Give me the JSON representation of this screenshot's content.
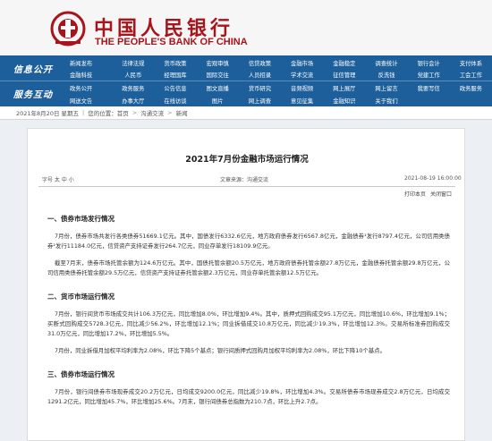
{
  "header": {
    "title_cn": "中国人民银行",
    "title_en": "THE PEOPLE'S BANK OF CHINA"
  },
  "nav": {
    "section1": "信息公开",
    "section2": "服务互动",
    "row1": [
      "新闻发布",
      "法律法规",
      "货币政策",
      "宏观审慎",
      "信贷政策",
      "金融市场",
      "金融稳定",
      "调查统计",
      "银行会计",
      "支付体系"
    ],
    "row2": [
      "金融科技",
      "人民币",
      "经理国库",
      "国际交往",
      "人员招录",
      "学术交流",
      "征信管理",
      "反洗钱",
      "党建工作",
      "工会工作"
    ],
    "row3": [
      "政务公开",
      "政务服务",
      "公告信息",
      "图文直播",
      "货币研究",
      "音频视频",
      "网上展厅",
      "网上留言",
      "我要写信",
      "政务服务"
    ],
    "row4": [
      "网送文告",
      "办事大厅",
      "在线访谈",
      "图片",
      "网上调查",
      "意见征集",
      "金融知识",
      "关于我们"
    ]
  },
  "breadcrumb": {
    "date": "2021年8月20日 星期五",
    "current_label": "您的位置：",
    "home": "首页",
    "section": "沟通交流",
    "page": "新闻"
  },
  "article": {
    "title": "2021年7月份金融市场运行情况",
    "font_label": "字号 太 中 小",
    "source": "文章来源：沟通交流",
    "date": "2021-08-19 16:00:00",
    "tools": [
      "打印本页",
      "关闭窗口"
    ],
    "h1": "一、债券市场发行情况",
    "p1": "7月份，债券市场共发行各类债券51669.1亿元。其中，国债发行6332.6亿元，地方政府债券发行6567.8亿元，金融债券¹发行8797.4亿元，公司信用类债券²发行11184.0亿元，信贷资产支持证券发行264.7亿元，同业存单发行18109.9亿元。",
    "p2": "截至7月末，债券市场托管余额为124.6万亿元。其中，国债托管余额20.5万亿元，地方政府债券托管余额27.8万亿元，金融债券托管余额29.8万亿元，公司信用类债券托管余额29.5万亿元，信贷资产支持证券托管余额2.3万亿元，同业存单托管余额12.5万亿元。",
    "h2": "二、货币市场运行情况",
    "p3": "7月份，银行间货币市场成交共计106.3万亿元，同比增加8.0%，环比增加9.4%。其中，质押式回购成交95.1万亿元，同比增加10.6%，环比增加9.1%；买断式回购成交5728.3亿元，同比减少56.2%，环比增加12.1%；同业拆借成交10.8万亿元，同比减少19.3%，环比增加12.3%。交易所标准券回购成交31.0万亿元，同比增加17.2%，环比增加5.5%。",
    "p4": "7月份，同业拆借月加权平均利率为2.08%，环比下降5个基点；银行间质押式回购月加权平均利率为2.08%，环比下降10个基点。",
    "h3": "三、债券市场运行情况",
    "p5": "7月份，银行间债券市场现券成交20.2万亿元，日均成交9200.0亿元，同比减少19.8%，环比增加4.3%。交易所债券市场现券成交2.8万亿元，日均成交1291.2亿元，同比增加45.7%，环比增加25.6%。7月末，银行间债券总指数为210.7点，环比上升2.7点。"
  }
}
